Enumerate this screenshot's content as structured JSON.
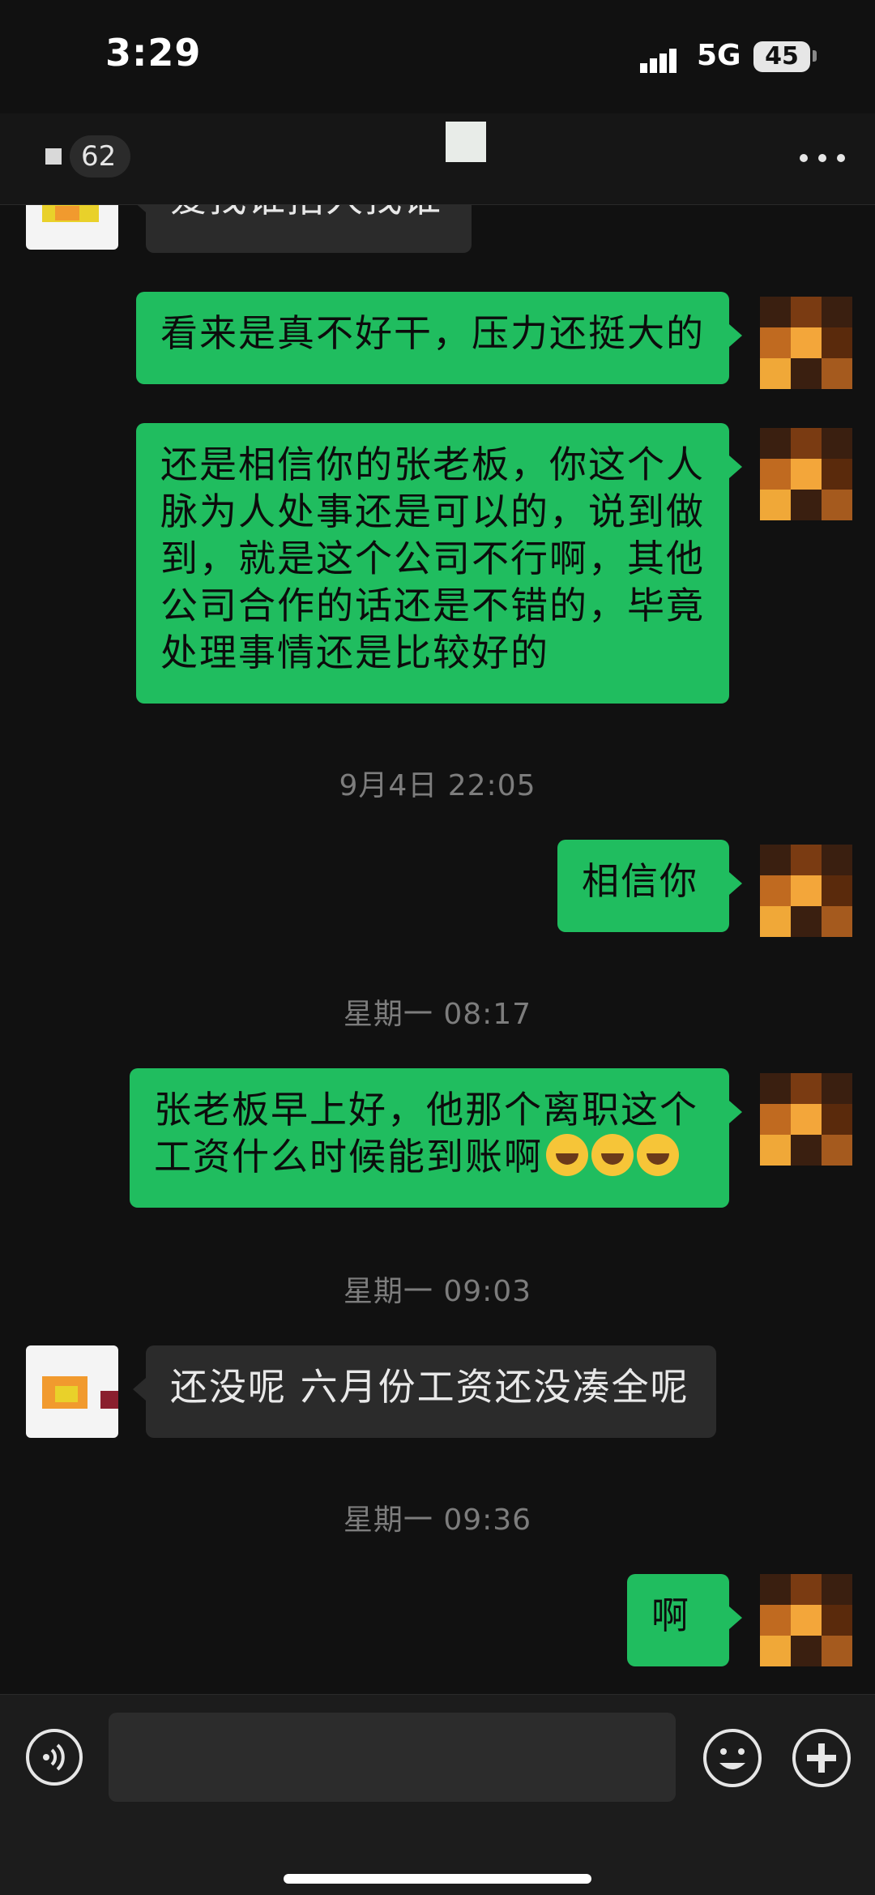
{
  "status": {
    "time": "3:29",
    "network": "5G",
    "battery": "45"
  },
  "nav": {
    "back_count": "62"
  },
  "messages": [
    {
      "text": "爱找谁招人找谁"
    },
    {
      "text": "看来是真不好干，压力还挺大的"
    },
    {
      "text": "还是相信你的张老板，你这个人脉为人处事还是可以的，说到做到，就是这个公司不行啊，其他公司合作的话还是不错的，毕竟处理事情还是比较好的"
    },
    {
      "text": "相信你"
    },
    {
      "text": "张老板早上好，他那个离职这个工资什么时候能到账啊"
    },
    {
      "text": "还没呢 六月份工资还没凑全呢"
    },
    {
      "text": "啊"
    }
  ],
  "timestamps": [
    "9月4日 22:05",
    "星期一 08:17",
    "星期一 09:03",
    "星期一 09:36"
  ],
  "input": {
    "value": "",
    "placeholder": ""
  },
  "icons": {
    "voice": "voice-icon",
    "emoji": "smiley-icon",
    "plus": "plus-icon",
    "more": "more-dots-icon"
  },
  "colors": {
    "my_bubble": "#20bd5f",
    "their_bubble": "#2b2b2b",
    "background": "#111111"
  }
}
